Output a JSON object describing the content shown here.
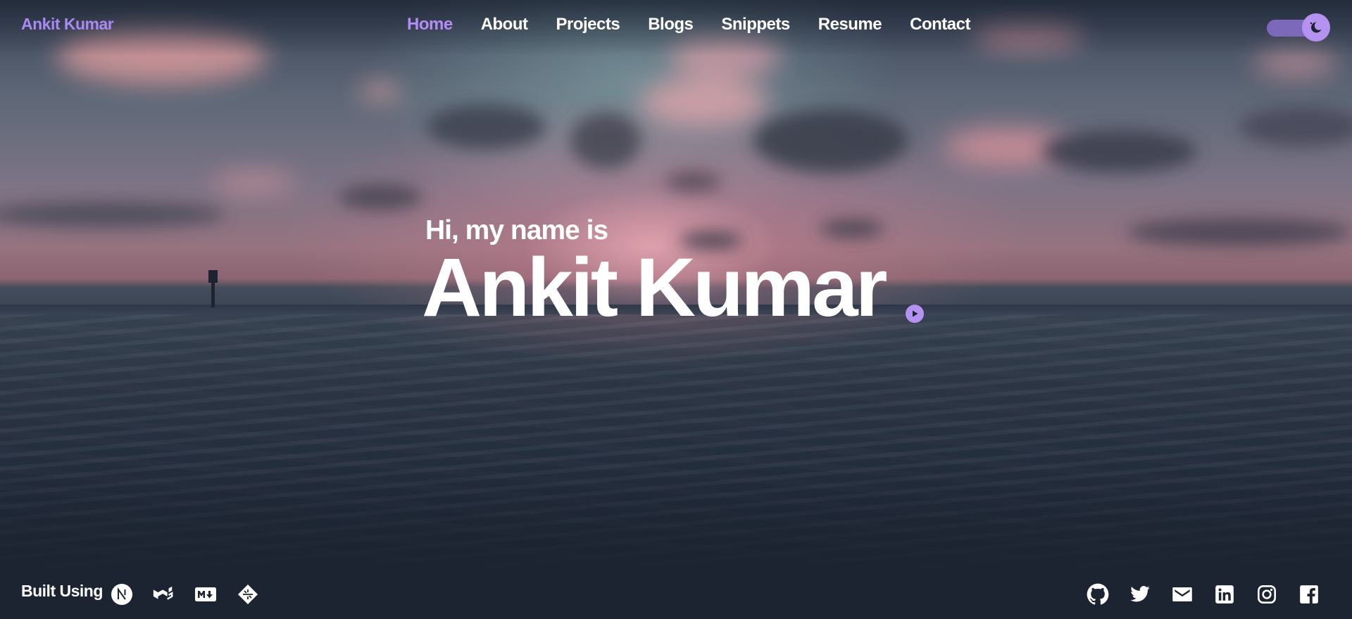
{
  "header": {
    "brand": "Ankit Kumar",
    "nav": [
      {
        "label": "Home",
        "active": true
      },
      {
        "label": "About",
        "active": false
      },
      {
        "label": "Projects",
        "active": false
      },
      {
        "label": "Blogs",
        "active": false
      },
      {
        "label": "Snippets",
        "active": false
      },
      {
        "label": "Resume",
        "active": false
      },
      {
        "label": "Contact",
        "active": false
      }
    ],
    "theme_toggle": {
      "icon": "moon-icon",
      "state": "dark"
    }
  },
  "hero": {
    "greeting": "Hi, my name is",
    "name": "Ankit Kumar",
    "play_icon": "play-icon"
  },
  "footer": {
    "built_label": "Built Using",
    "tech_icons": [
      "nextjs-icon",
      "mui-icon",
      "markdown-icon",
      "netlify-icon"
    ],
    "social_icons": [
      "github-icon",
      "twitter-icon",
      "email-icon",
      "linkedin-icon",
      "instagram-icon",
      "facebook-icon"
    ]
  },
  "colors": {
    "accent": "#b592f0",
    "brand": "#a88af2",
    "text": "#ffffff",
    "background": "#1c2432"
  }
}
